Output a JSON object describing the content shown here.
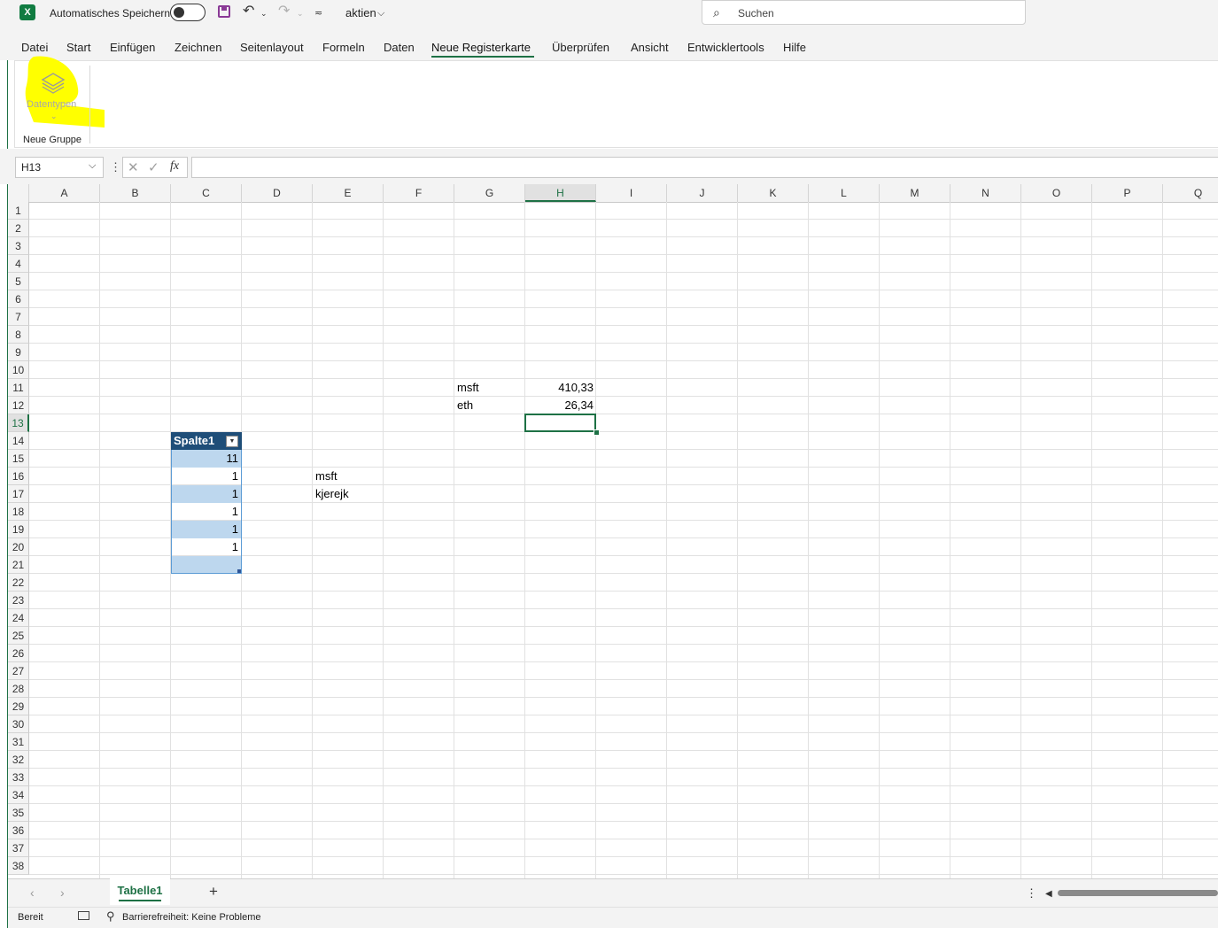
{
  "titlebar": {
    "autosave_label": "Automatisches Speichern",
    "workbook_name": "aktien",
    "search_placeholder": "Suchen"
  },
  "menu": {
    "items": [
      "Datei",
      "Start",
      "Einfügen",
      "Zeichnen",
      "Seitenlayout",
      "Formeln",
      "Daten",
      "Neue Registerkarte",
      "Überprüfen",
      "Ansicht",
      "Entwicklertools",
      "Hilfe"
    ],
    "active": "Neue Registerkarte"
  },
  "ribbon": {
    "datentypen_label": "Datentypen",
    "group_label": "Neue Gruppe",
    "highlight_color": "#ffff00"
  },
  "formula_bar": {
    "name_box": "H13",
    "fx_label": "fx",
    "formula": ""
  },
  "grid": {
    "columns": [
      "A",
      "B",
      "C",
      "D",
      "E",
      "F",
      "G",
      "H",
      "I",
      "J",
      "K",
      "L",
      "M",
      "N",
      "O",
      "P",
      "Q"
    ],
    "rows": [
      "1",
      "2",
      "3",
      "4",
      "5",
      "6",
      "7",
      "8",
      "9",
      "10",
      "11",
      "12",
      "13",
      "14",
      "15",
      "16",
      "17",
      "18",
      "19",
      "20",
      "21",
      "22",
      "23",
      "24",
      "25",
      "26",
      "27",
      "28",
      "29",
      "30",
      "31",
      "32",
      "33",
      "34",
      "35",
      "36",
      "37",
      "38"
    ],
    "selected_column": "H",
    "selected_row": "13",
    "cells": {
      "G11": "msft",
      "H11": "410,33",
      "G12": "eth",
      "H12": "26,34",
      "E16": "msft",
      "E17": "kjerejk"
    },
    "table": {
      "header": "Spalte1",
      "values": [
        "11",
        "1",
        "1",
        "1",
        "1",
        "1",
        ""
      ],
      "header_color": "#1f4e78",
      "band_color": "#bdd7ee"
    }
  },
  "sheets": {
    "tabs": [
      "Tabelle1"
    ],
    "active": "Tabelle1",
    "add_label": "+"
  },
  "status": {
    "ready": "Bereit",
    "accessibility": "Barrierefreiheit: Keine Probleme"
  },
  "colors": {
    "accent": "#1e7145",
    "excel_brand": "#107c41"
  }
}
